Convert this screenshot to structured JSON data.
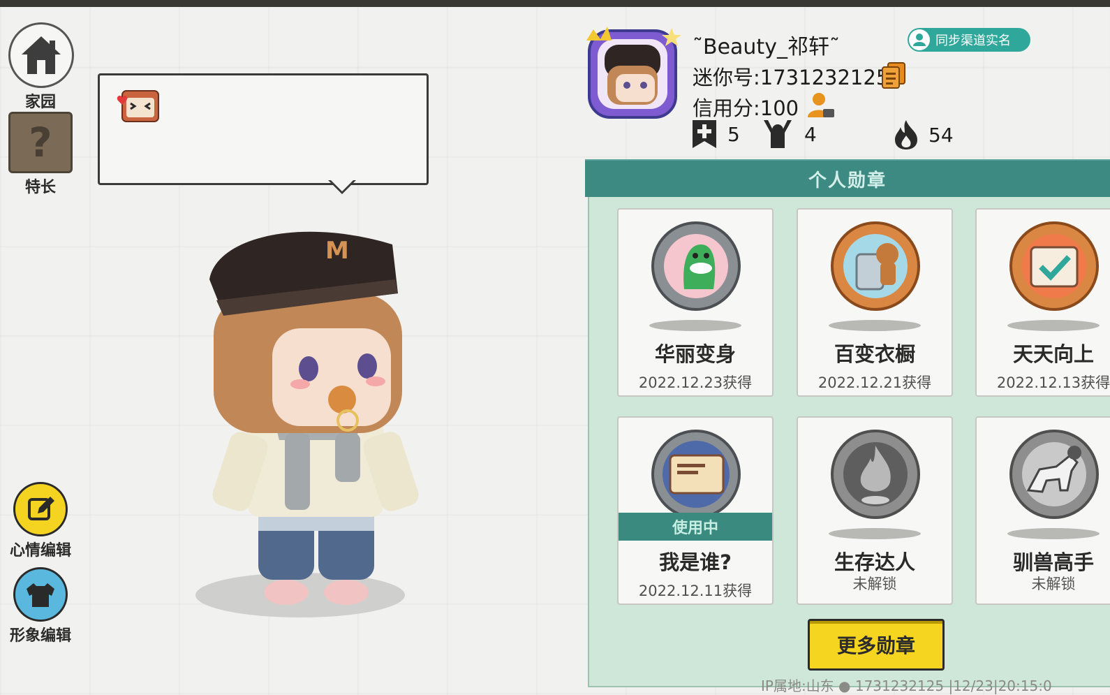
{
  "nav": {
    "home_label": "家园",
    "talent_label": "特长",
    "mood_edit_label": "心情编辑",
    "avatar_edit_label": "形象编辑"
  },
  "profile": {
    "name": "˜Beauty_祁轩˜",
    "mini_id": "迷你号:1731232125",
    "credit": "信用分:100",
    "sync_badge": "同步渠道实名",
    "stats": [
      {
        "icon": "add-bookmark-icon",
        "value": "5"
      },
      {
        "icon": "fans-icon",
        "value": "4"
      },
      {
        "icon": "fire-icon",
        "value": "54"
      }
    ]
  },
  "medals": {
    "header": "个人勋章",
    "items": [
      {
        "title": "华丽变身",
        "date": "2022.12.23获得",
        "icon": "dino-costume-medal-icon"
      },
      {
        "title": "百变衣橱",
        "date": "2022.12.21获得",
        "icon": "bear-wardrobe-medal-icon"
      },
      {
        "title": "天天向上",
        "date": "2022.12.13获得",
        "icon": "calendar-medal-icon"
      },
      {
        "title": "我是谁?",
        "date": "2022.12.11获得",
        "status": "使用中",
        "icon": "id-card-medal-icon"
      },
      {
        "title": "生存达人",
        "status": "未解锁",
        "icon": "campfire-medal-icon"
      },
      {
        "title": "驯兽高手",
        "status": "未解锁",
        "icon": "horse-medal-icon"
      }
    ],
    "more_button": "更多勋章"
  },
  "footer": "IP属地:山东 ● 1731232125 |12/23|20:15:0"
}
